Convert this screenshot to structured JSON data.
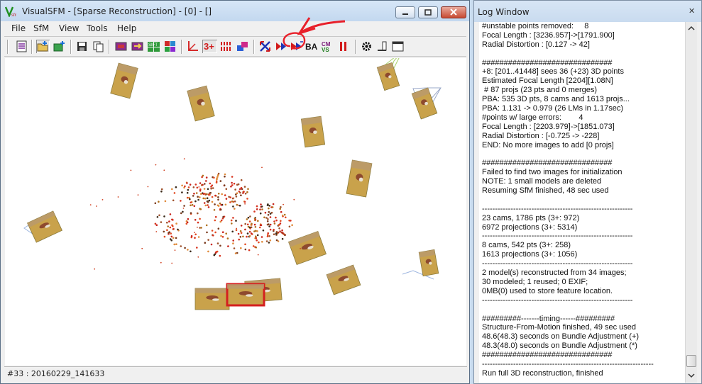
{
  "visualsfm": {
    "title": "VisualSFM - [Sparse Reconstruction] - [0] - []",
    "menu": [
      "File",
      "SfM",
      "View",
      "Tools",
      "Help"
    ],
    "toolbar_text": {
      "three_plus": "3+",
      "ba": "BA"
    },
    "status": "#33 : 20160229_141633",
    "annotation_color": "#e8202a"
  },
  "log_window": {
    "title": "Log Window",
    "close_glyph": "✕",
    "lines": [
      "#unstable points removed:     8",
      "Focal Length : [3236.957]->[1791.900]",
      "Radial Distortion : [0.127 -> 42]",
      "",
      "##############################",
      "+8: [201..41448] sees 36 (+23) 3D points",
      "Estimated Focal Length [2204][1.08N]",
      " # 87 projs (23 pts and 0 merges)",
      "PBA: 535 3D pts, 8 cams and 1613 projs...",
      "PBA: 1.131 -> 0.979 (26 LMs in 1.17sec)",
      "#points w/ large errors:        4",
      "Focal Length : [2203.979]->[1851.073]",
      "Radial Distortion : [-0.725 -> -228]",
      "END: No more images to add [0 projs]",
      "",
      "##############################",
      "Failed to find two images for initialization",
      "NOTE: 1 small models are deleted",
      "Resuming SfM finished, 48 sec used",
      "",
      "----------------------------------------------------------",
      "23 cams, 1786 pts (3+: 972)",
      "6972 projections (3+: 5314)",
      "----------------------------------------------------------",
      "8 cams, 542 pts (3+: 258)",
      "1613 projections (3+: 1056)",
      "----------------------------------------------------------",
      "2 model(s) reconstructed from 34 images;",
      "30 modeled; 1 reused; 0 EXIF;",
      "0MB(0) used to store feature location.",
      "----------------------------------------------------------",
      "",
      "#########-------timing------#########",
      "Structure-From-Motion finished, 49 sec used",
      "48.6(48.3) seconds on Bundle Adjustment (+)",
      "48.3(48.0) seconds on Bundle Adjustment (*)",
      "##############################",
      "------------------------------------------------------------------",
      "Run full 3D reconstruction, finished"
    ]
  }
}
